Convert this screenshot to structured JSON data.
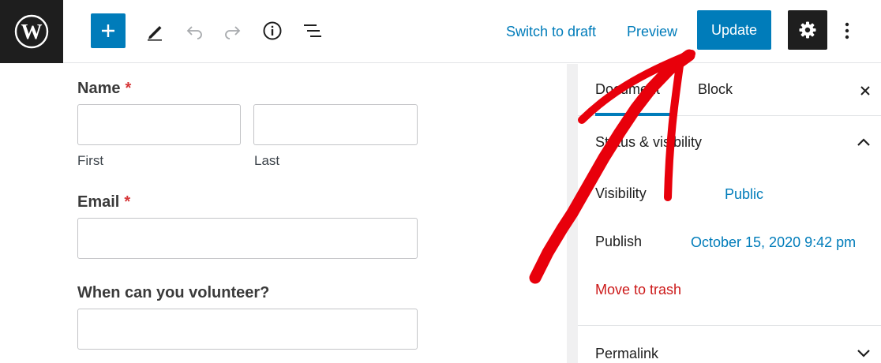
{
  "toolbar": {
    "switch_to_draft": "Switch to draft",
    "preview": "Preview",
    "update": "Update"
  },
  "form": {
    "name_label": "Name",
    "required_mark": "*",
    "first_label": "First",
    "last_label": "Last",
    "email_label": "Email",
    "volunteer_label": "When can you volunteer?"
  },
  "sidebar": {
    "tab_document": "Document",
    "tab_block": "Block",
    "status_panel_title": "Status & visibility",
    "visibility_label": "Visibility",
    "visibility_value": "Public",
    "publish_label": "Publish",
    "publish_value": "October 15, 2020 9:42 pm",
    "move_to_trash": "Move to trash",
    "permalink_title": "Permalink"
  },
  "colors": {
    "accent": "#007cba",
    "danger": "#cc1818",
    "annotation": "#e8000b"
  },
  "icons": [
    "wordpress-logo-icon",
    "plus-icon",
    "pencil-icon",
    "undo-icon",
    "redo-icon",
    "info-icon",
    "list-view-icon",
    "gear-icon",
    "more-vertical-icon",
    "close-icon",
    "chevron-up-icon",
    "chevron-down-icon"
  ]
}
